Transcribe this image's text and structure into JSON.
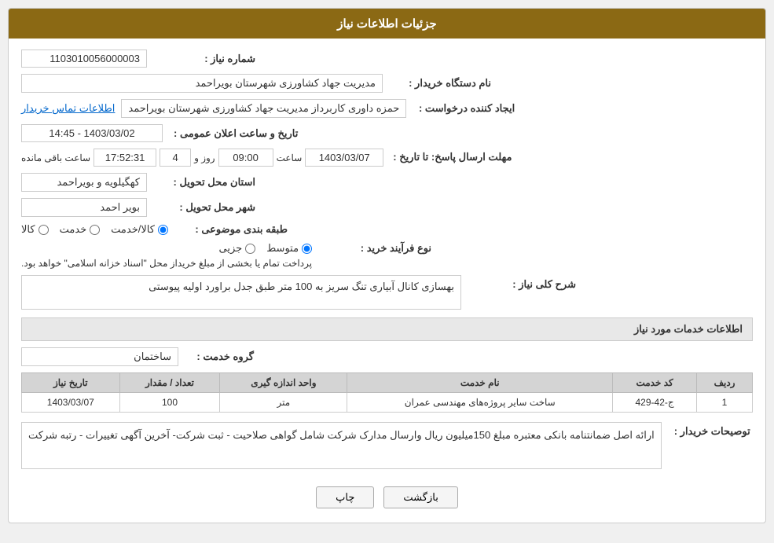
{
  "header": {
    "title": "جزئیات اطلاعات نیاز"
  },
  "fields": {
    "need_number_label": "شماره نیاز :",
    "need_number_value": "1103010056000003",
    "buyer_org_label": "نام دستگاه خریدار :",
    "buyer_org_value": "مدیریت جهاد کشاورزی شهرستان بویراحمد",
    "creator_label": "ایجاد کننده درخواست :",
    "creator_value": "حمزه داوری کاربرداز مدیریت جهاد کشاورزی شهرستان بویراحمد",
    "contact_link": "اطلاعات تماس خریدار",
    "announce_date_label": "تاریخ و ساعت اعلان عمومی :",
    "announce_date_value": "1403/03/02 - 14:45",
    "deadline_label": "مهلت ارسال پاسخ: تا تاریخ :",
    "deadline_date": "1403/03/07",
    "deadline_time_label": "ساعت",
    "deadline_time": "09:00",
    "deadline_days_label": "روز و",
    "deadline_days": "4",
    "deadline_remaining_label": "ساعت باقی مانده",
    "deadline_remaining": "17:52:31",
    "province_label": "استان محل تحویل :",
    "province_value": "کهگیلویه و بویراحمد",
    "city_label": "شهر محل تحویل :",
    "city_value": "بویر احمد",
    "category_label": "طبقه بندی موضوعی :",
    "category_kala": "کالا",
    "category_khadamat": "خدمت",
    "category_kala_khadamat": "کالا/خدمت",
    "category_selected": "kala_khadamat",
    "purchase_type_label": "نوع فرآیند خرید :",
    "purchase_jozei": "جزیی",
    "purchase_motevaset": "متوسط",
    "purchase_note": "پرداخت تمام یا بخشی از مبلغ خریداز محل \"اسناد خزانه اسلامی\" خواهد بود.",
    "need_desc_label": "شرح کلی نیاز :",
    "need_desc_value": "بهسازی کانال آبیاری تنگ سریز به 100 متر طبق جدل براورد اولیه پیوستی",
    "services_section_label": "اطلاعات خدمات مورد نیاز",
    "service_group_label": "گروه خدمت :",
    "service_group_value": "ساختمان",
    "table_headers": [
      "ردیف",
      "کد خدمت",
      "نام خدمت",
      "واحد اندازه گیری",
      "تعداد / مقدار",
      "تاریخ نیاز"
    ],
    "table_rows": [
      {
        "row": "1",
        "code": "ج-42-429",
        "name": "ساخت سایر پروژه‌های مهندسی عمران",
        "unit": "متر",
        "qty": "100",
        "date": "1403/03/07"
      }
    ],
    "buyer_desc_label": "توصیحات خریدار :",
    "buyer_desc_value": "ارائه اصل ضمانتنامه بانکی معتبره مبلغ  150میلیون ریال  وارسال مدارک شرکت شامل گواهی صلاحیت - ثبت شرکت- آخرین آگهی تغییرات - رتبه شرکت"
  },
  "buttons": {
    "print_label": "چاپ",
    "back_label": "بازگشت"
  }
}
